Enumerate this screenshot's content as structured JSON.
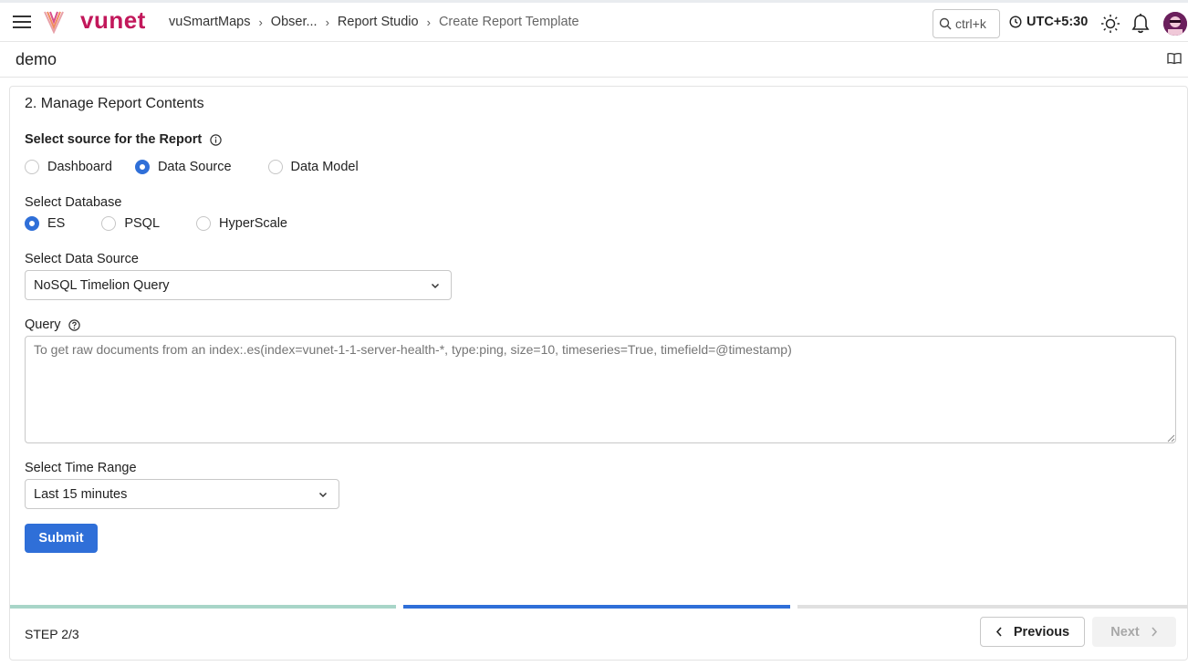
{
  "nav": {
    "logo_text": "vunet",
    "breadcrumbs": [
      {
        "label": "vuSmartMaps"
      },
      {
        "label": "Obser..."
      },
      {
        "label": "Report Studio"
      },
      {
        "label": "Create Report Template"
      }
    ],
    "search_shortcut": "ctrl+k",
    "timezone": "UTC+5:30"
  },
  "page": {
    "title": "demo"
  },
  "form": {
    "section_title": "2. Manage Report Contents",
    "source_label": "Select source for the Report",
    "source_options": [
      {
        "label": "Dashboard",
        "selected": false
      },
      {
        "label": "Data Source",
        "selected": true
      },
      {
        "label": "Data Model",
        "selected": false
      }
    ],
    "database_label": "Select Database",
    "database_options": [
      {
        "label": "ES",
        "selected": true
      },
      {
        "label": "PSQL",
        "selected": false
      },
      {
        "label": "HyperScale",
        "selected": false
      }
    ],
    "data_source_label": "Select Data Source",
    "data_source_value": "NoSQL Timelion Query",
    "query_label": "Query",
    "query_placeholder": "To get raw documents from an index:.es(index=vunet-1-1-server-health-*, type:ping, size=10, timeseries=True, timefield=@timestamp)",
    "time_range_label": "Select Time Range",
    "time_range_value": "Last 15 minutes",
    "submit_label": "Submit"
  },
  "footer": {
    "step_text": "STEP 2/3",
    "step_progress": {
      "current": 2,
      "total": 3
    },
    "previous_label": "Previous",
    "next_label": "Next"
  },
  "colors": {
    "brand": "#c2185b",
    "accent": "#2f6fd8",
    "step_done": "#a8d5c8",
    "step_active": "#2f6fd8",
    "step_pending": "#e0e0e0"
  }
}
